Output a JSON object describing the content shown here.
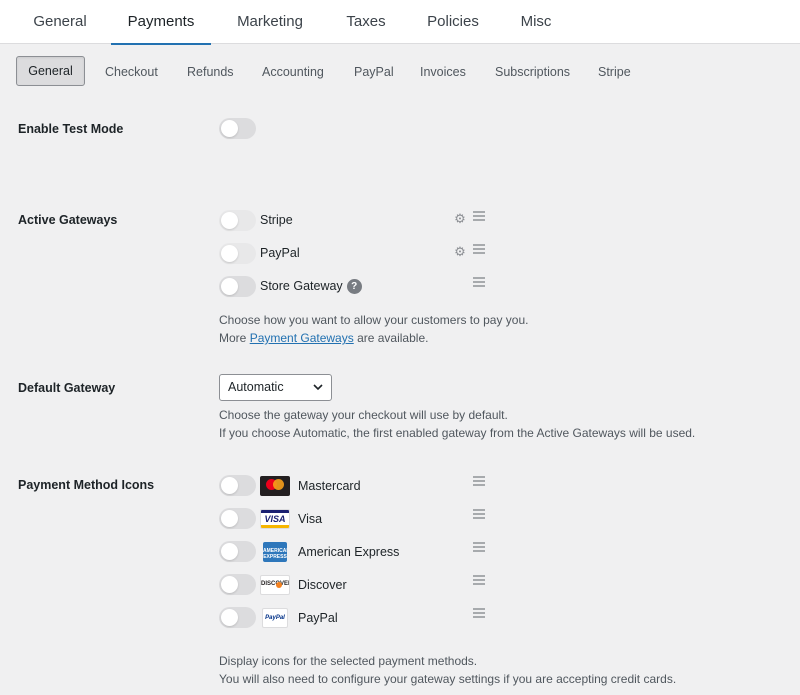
{
  "top_tabs": [
    "General",
    "Payments",
    "Marketing",
    "Taxes",
    "Policies",
    "Misc"
  ],
  "top_tabs_active": "Payments",
  "sub_tabs": [
    "General",
    "Checkout",
    "Refunds",
    "Accounting",
    "PayPal",
    "Invoices",
    "Subscriptions",
    "Stripe"
  ],
  "sub_tabs_active": "General",
  "test_mode": {
    "label": "Enable Test Mode",
    "enabled": false
  },
  "active_gateways": {
    "label": "Active Gateways",
    "items": [
      {
        "name": "Stripe",
        "enabled": false,
        "has_settings": true
      },
      {
        "name": "PayPal",
        "enabled": false,
        "has_settings": true
      },
      {
        "name": "Store Gateway",
        "enabled": false,
        "has_settings": false,
        "has_help": true
      }
    ],
    "help_line1": "Choose how you want to allow your customers to pay you.",
    "help_more_prefix": "More ",
    "help_link": "Payment Gateways",
    "help_more_suffix": " are available.",
    "help_icon": "?"
  },
  "default_gateway": {
    "label": "Default Gateway",
    "selected": "Automatic",
    "help_line1": "Choose the gateway your checkout will use by default.",
    "help_line2": "If you choose Automatic, the first enabled gateway from the Active Gateways will be used."
  },
  "payment_method_icons": {
    "label": "Payment Method Icons",
    "items": [
      {
        "name": "Mastercard",
        "icon": "mastercard-icon",
        "enabled": false
      },
      {
        "name": "Visa",
        "icon": "visa-icon",
        "enabled": false,
        "logo_text": "VISA"
      },
      {
        "name": "American Express",
        "icon": "amex-icon",
        "enabled": false,
        "logo_text": "AMERICAN EXPRESS"
      },
      {
        "name": "Discover",
        "icon": "discover-icon",
        "enabled": false,
        "logo_text": "DISCOVER"
      },
      {
        "name": "PayPal",
        "icon": "paypal-icon",
        "enabled": false,
        "logo_text": "PayPal"
      }
    ],
    "help_line1": "Display icons for the selected payment methods.",
    "help_line2": "You will also need to configure your gateway settings if you are accepting credit cards."
  },
  "colors": {
    "accent": "#2271b1",
    "background": "#f0f0f1",
    "toggle_off": "#dcdcde"
  }
}
